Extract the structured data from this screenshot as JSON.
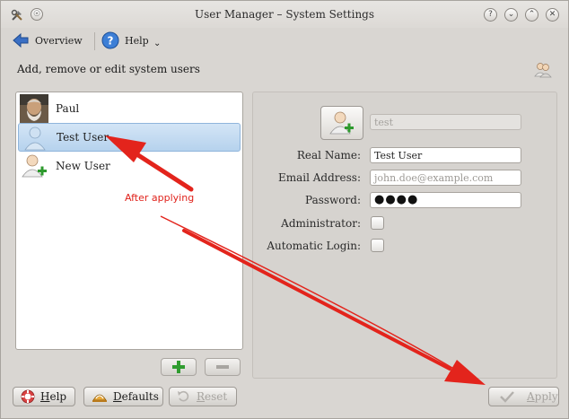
{
  "window": {
    "title": "User Manager – System Settings",
    "pin_glyph": "☉",
    "controls": [
      "?",
      "⌄",
      "⌃",
      "✕"
    ]
  },
  "toolbar": {
    "overview_label": "Overview",
    "help_label": "Help",
    "chevron": "⌄"
  },
  "page": {
    "heading": "Add, remove or edit system users"
  },
  "users": [
    {
      "name": "Paul",
      "icon": "photo-avatar-icon",
      "selected": false
    },
    {
      "name": "Test User",
      "icon": "user-avatar-icon",
      "selected": true
    },
    {
      "name": "New User",
      "icon": "add-user-icon",
      "selected": false
    }
  ],
  "list_buttons": {
    "add_icon": "plus-icon",
    "remove_icon": "minus-icon"
  },
  "details": {
    "username": {
      "value": "test"
    },
    "real_name": {
      "label": "Real Name:",
      "value": "Test User"
    },
    "email": {
      "label": "Email Address:",
      "placeholder": "john.doe@example.com"
    },
    "password": {
      "label": "Password:",
      "value": "●●●●"
    },
    "administrator": {
      "label": "Administrator:",
      "checked": false
    },
    "automatic_login": {
      "label": "Automatic Login:",
      "checked": false
    }
  },
  "bottom": {
    "help": {
      "pre": "",
      "ul": "H",
      "post": "elp"
    },
    "defaults": {
      "pre": "",
      "ul": "D",
      "post": "efaults"
    },
    "reset": {
      "pre": "",
      "ul": "R",
      "post": "eset"
    },
    "apply": {
      "pre": "",
      "ul": "A",
      "post": "pply"
    }
  },
  "annotation": {
    "text": "After applying",
    "color": "#e0221b"
  },
  "colors": {
    "selection": "#b6d2ed",
    "window_bg": "#d9d6d2",
    "arrow_red": "#e0221b"
  }
}
